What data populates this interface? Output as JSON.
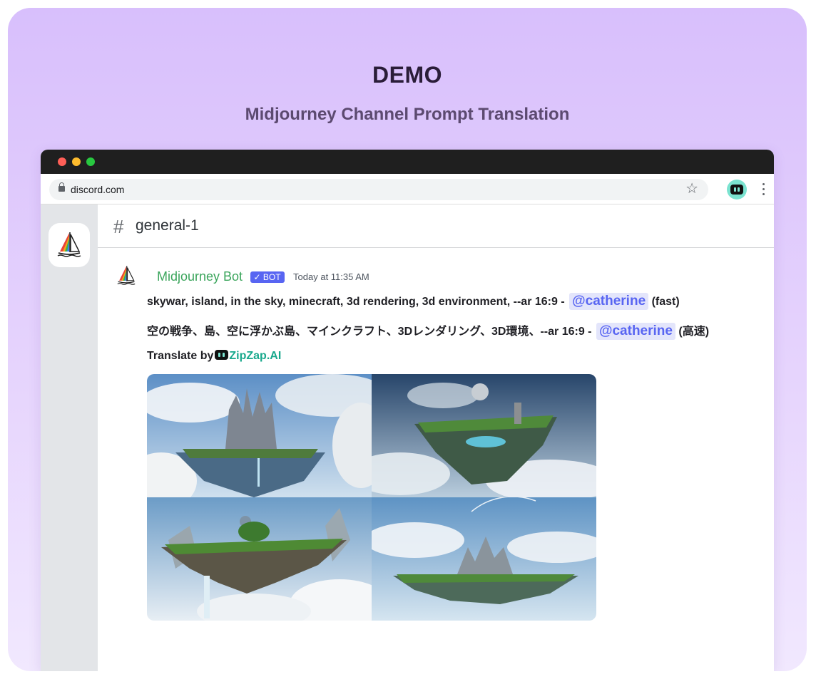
{
  "hero": {
    "title": "DEMO",
    "subtitle": "Midjourney Channel Prompt Translation"
  },
  "browser": {
    "url": "discord.com"
  },
  "channel": {
    "name": "general-1"
  },
  "message": {
    "author": "Midjourney Bot",
    "badge": "✓ BOT",
    "timestamp": "Today at 11:35 AM",
    "prompt_en": "skywar, island, in the sky, minecraft, 3d rendering, 3d environment, --ar 16:9 -",
    "mention": "@catherine",
    "mode_en": "(fast)",
    "prompt_ja": "空の戦争、島、空に浮かぶ島、マインクラフト、3Dレンダリング、3D環境、--ar 16:9 -",
    "mode_ja": "(高速)",
    "translate_prefix": "Translate by",
    "translate_brand": "ZipZap.AI"
  },
  "images": [
    {
      "name": "floating-castle-island"
    },
    {
      "name": "floating-ruins-island"
    },
    {
      "name": "floating-forest-island-waterfall"
    },
    {
      "name": "floating-mountain-island"
    }
  ],
  "colors": {
    "accent_green": "#3ba55c",
    "bot_badge": "#5865f2",
    "mention_text": "#5865f2",
    "brand_teal": "#19a98d"
  }
}
